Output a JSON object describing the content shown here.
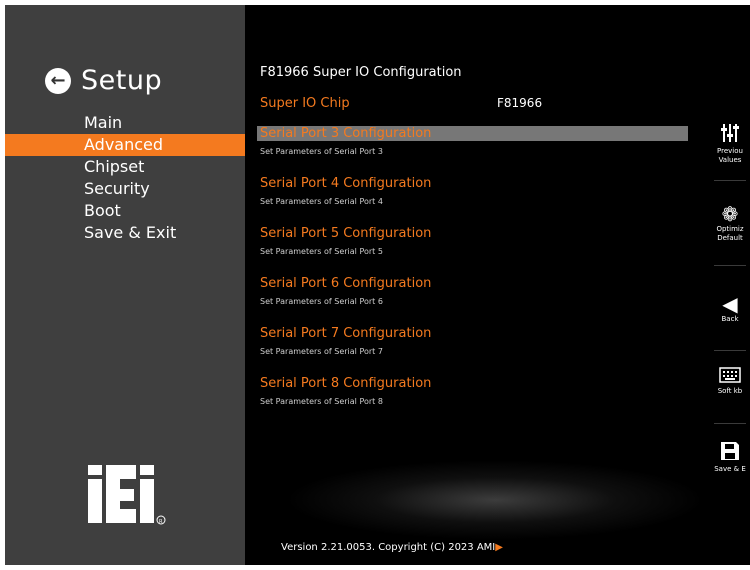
{
  "sidebar": {
    "title": "Setup",
    "items": [
      {
        "label": "Main"
      },
      {
        "label": "Advanced"
      },
      {
        "label": "Chipset"
      },
      {
        "label": "Security"
      },
      {
        "label": "Boot"
      },
      {
        "label": "Save & Exit"
      }
    ],
    "active_index": 1,
    "logo_text": "iEi"
  },
  "main": {
    "section_title": "F81966 Super IO Configuration",
    "chip": {
      "label": "Super IO Chip",
      "value": "F81966"
    },
    "items": [
      {
        "title": "Serial Port 3 Configuration",
        "desc": "Set Parameters of Serial Port 3"
      },
      {
        "title": "Serial Port 4 Configuration",
        "desc": "Set Parameters of Serial Port 4"
      },
      {
        "title": "Serial Port 5 Configuration",
        "desc": "Set Parameters of Serial Port 5"
      },
      {
        "title": "Serial Port 6 Configuration",
        "desc": "Set Parameters of Serial Port 6"
      },
      {
        "title": "Serial Port 7 Configuration",
        "desc": "Set Parameters of Serial Port 7"
      },
      {
        "title": "Serial Port 8 Configuration",
        "desc": "Set Parameters of Serial Port 8"
      }
    ],
    "selected_index": 0,
    "version": "Version 2.21.0053. Copyright (C) 2023 AMI"
  },
  "right_panel": {
    "buttons": [
      {
        "label_line1": "Previou",
        "label_line2": "Values",
        "icon": "sliders-icon"
      },
      {
        "label_line1": "Optimiz",
        "label_line2": "Default",
        "icon": "gear-icon"
      },
      {
        "label_line1": "Back",
        "label_line2": "",
        "icon": "back-triangle-icon"
      },
      {
        "label_line1": "Soft kb",
        "label_line2": "",
        "icon": "keyboard-icon"
      },
      {
        "label_line1": "Save & E",
        "label_line2": "",
        "icon": "floppy-icon"
      }
    ]
  },
  "colors": {
    "accent": "#f47a1f",
    "sidebar_bg": "#3f3f3f",
    "highlight_bg": "#777777"
  }
}
